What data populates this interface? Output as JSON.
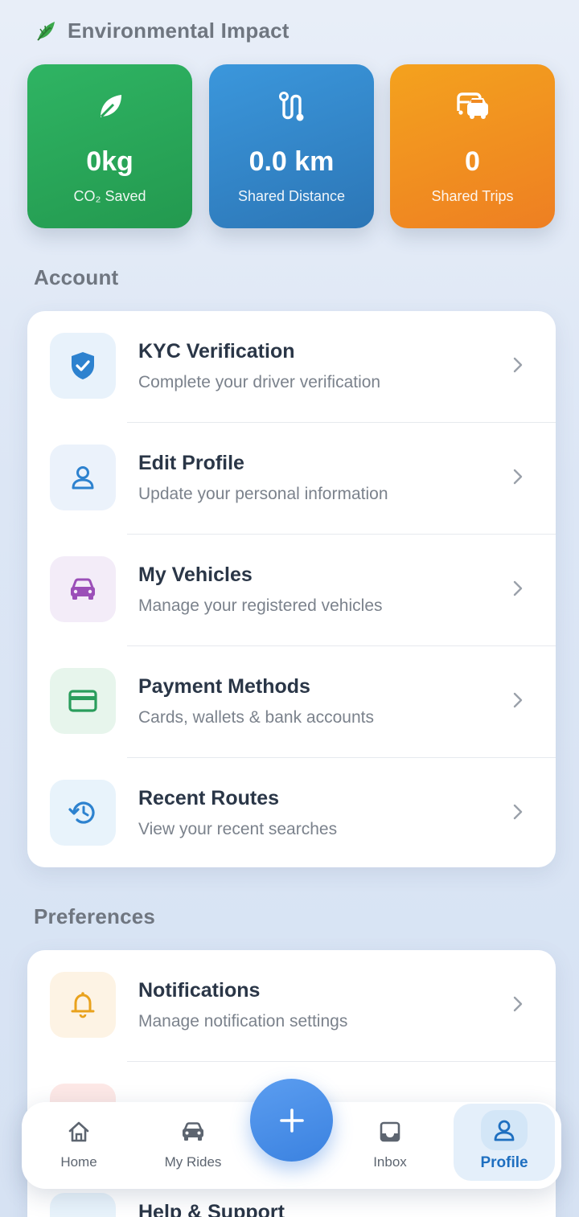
{
  "environmental_impact": {
    "heading": "Environmental Impact",
    "heading_icon": "leaf-icon",
    "stats": [
      {
        "value": "0kg",
        "label": "CO₂ Saved",
        "icon": "leaf-icon",
        "color": "#2fb463"
      },
      {
        "value": "0.0 km",
        "label": "Shared Distance",
        "icon": "route-icon",
        "color": "#3b97dc"
      },
      {
        "value": "0",
        "label": "Shared Trips",
        "icon": "car-multiple-icon",
        "color": "#f4a21e"
      }
    ]
  },
  "account": {
    "heading": "Account",
    "items": [
      {
        "title": "KYC Verification",
        "subtitle": "Complete your driver verification",
        "icon": "shield-check-icon",
        "accent": "#2d82cf"
      },
      {
        "title": "Edit Profile",
        "subtitle": "Update your personal information",
        "icon": "user-icon",
        "accent": "#2d82cf"
      },
      {
        "title": "My Vehicles",
        "subtitle": "Manage your registered vehicles",
        "icon": "car-icon",
        "accent": "#9b4fb8"
      },
      {
        "title": "Payment Methods",
        "subtitle": "Cards, wallets & bank accounts",
        "icon": "credit-card-icon",
        "accent": "#2a9d5c"
      },
      {
        "title": "Recent Routes",
        "subtitle": "View your recent searches",
        "icon": "history-icon",
        "accent": "#2d82cf"
      }
    ]
  },
  "preferences": {
    "heading": "Preferences",
    "items": [
      {
        "title": "Notifications",
        "subtitle": "Manage notification settings",
        "icon": "bell-icon",
        "accent": "#e9a21d"
      },
      {
        "title": "Help & Support",
        "icon": "help-icon",
        "accent": "#2d82cf"
      }
    ]
  },
  "bottom_nav": {
    "items": [
      {
        "label": "Home",
        "icon": "home-icon"
      },
      {
        "label": "My Rides",
        "icon": "car-icon"
      },
      {
        "label": "Inbox",
        "icon": "inbox-icon"
      },
      {
        "label": "Profile",
        "icon": "profile-icon",
        "active": true
      }
    ],
    "fab_icon": "plus-icon"
  }
}
